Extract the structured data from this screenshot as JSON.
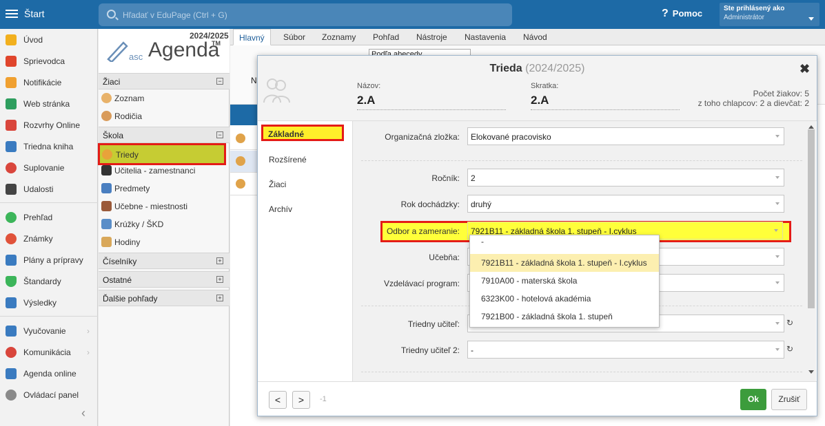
{
  "topbar": {
    "start": "Štart",
    "search_placeholder": "Hľadať v EduPage (Ctrl + G)",
    "help": "Pomoc",
    "user_line1": "Ste prihlásený ako",
    "user_line2": "Administrátor"
  },
  "leftnav": [
    {
      "label": "Úvod",
      "icon": "star-icon",
      "color": "#f2b01e"
    },
    {
      "label": "Sprievodca",
      "icon": "wand-icon",
      "color": "#e0452c"
    },
    {
      "label": "Notifikácie",
      "icon": "envelope-icon",
      "color": "#f0a030"
    },
    {
      "label": "Web stránka",
      "icon": "home-icon",
      "color": "#2e9e5e"
    },
    {
      "label": "Rozvrhy Online",
      "icon": "timetable-icon",
      "color": "#d9463c"
    },
    {
      "label": "Triedna kniha",
      "icon": "book-icon",
      "color": "#3a7bc0"
    },
    {
      "label": "Suplovanie",
      "icon": "substitute-icon",
      "color": "#d9463c"
    },
    {
      "label": "Udalosti",
      "icon": "calendar-icon",
      "color": "#444444"
    },
    {
      "label": "Prehľad",
      "icon": "check-circle-icon",
      "color": "#3cb55a"
    },
    {
      "label": "Známky",
      "icon": "grades-icon",
      "color": "#e0523a"
    },
    {
      "label": "Plány a prípravy",
      "icon": "briefcase-icon",
      "color": "#3a7bc0"
    },
    {
      "label": "Štandardy",
      "icon": "shield-icon",
      "color": "#3cb55a"
    },
    {
      "label": "Výsledky",
      "icon": "barchart-icon",
      "color": "#3a7bc0"
    },
    {
      "label": "Vyučovanie",
      "icon": "book-open-icon",
      "color": "#3a7bc0",
      "chev": "›"
    },
    {
      "label": "Komunikácia",
      "icon": "chat-icon",
      "color": "#d9463c",
      "chev": "›"
    },
    {
      "label": "Agenda online",
      "icon": "pen-icon",
      "color": "#3a7bc0"
    },
    {
      "label": "Ovládací panel",
      "icon": "gear-icon",
      "color": "#8a8a8a"
    }
  ],
  "leftnav_collapse": "‹",
  "panel": {
    "year": "2024/2025",
    "logo_asc": "asc",
    "logo_agenda": "Agenda",
    "logo_tm": "TM",
    "sec_ziaci": "Žiaci",
    "zoznam": "Zoznam",
    "rodicia": "Rodičia",
    "sec_skola": "Škola",
    "triedy": "Triedy",
    "ucitelia": "Učitelia - zamestnanci",
    "predmety": "Predmety",
    "ucebne": "Učebne - miestnosti",
    "kruzky": "Krúžky / ŠKD",
    "hodiny": "Hodiny",
    "sec_ciselniky": "Číselníky",
    "sec_ostatne": "Ostatné",
    "sec_dalsie": "Ďalšie pohľady",
    "minus": "−",
    "plus": "+"
  },
  "tabs": [
    "Hlavný",
    "Súbor",
    "Zoznamy",
    "Pohľad",
    "Nástroje",
    "Nastavenia",
    "Návod"
  ],
  "ribbon": {
    "sort_select": "Podľa abecedy",
    "partial_label": "N"
  },
  "dialog": {
    "title": "Trieda",
    "title_year": "(2024/2025)",
    "close": "✖",
    "name_label": "Názov:",
    "name_value": "2.A",
    "abbr_label": "Skratka:",
    "abbr_value": "2.A",
    "stat1": "Počet žiakov: 5",
    "stat2": "z toho chlapcov: 2 a dievčat: 2",
    "nav": [
      "Základné",
      "Rozšírené",
      "Žiaci",
      "Archív"
    ],
    "labels": {
      "org": "Organizačná zložka:",
      "rocnik": "Ročník:",
      "rok": "Rok dochádzky:",
      "odbor": "Odbor a zameranie:",
      "ucebna": "Učebňa:",
      "program": "Vzdelávací program:",
      "ucitel": "Triedny učiteľ:",
      "ucitel2": "Triedny učiteľ 2:"
    },
    "values": {
      "org": "Elokované pracovisko",
      "rocnik": "2",
      "rok": "druhý",
      "odbor": "7921B11 - základná škola 1. stupeň - I.cyklus",
      "ucebna": "",
      "program": "",
      "ucitel": "",
      "ucitel2": "-"
    },
    "refresh": "↻",
    "dropdown": [
      "-",
      "7921B11 - základná škola 1. stupeň - I.cyklus",
      "7910A00 - materská škola",
      "6323K00 - hotelová akadémia",
      "7921B00 - základná škola 1. stupeň"
    ],
    "prev": "<",
    "next": ">",
    "page": "-1",
    "ok": "Ok",
    "cancel": "Zrušiť"
  }
}
